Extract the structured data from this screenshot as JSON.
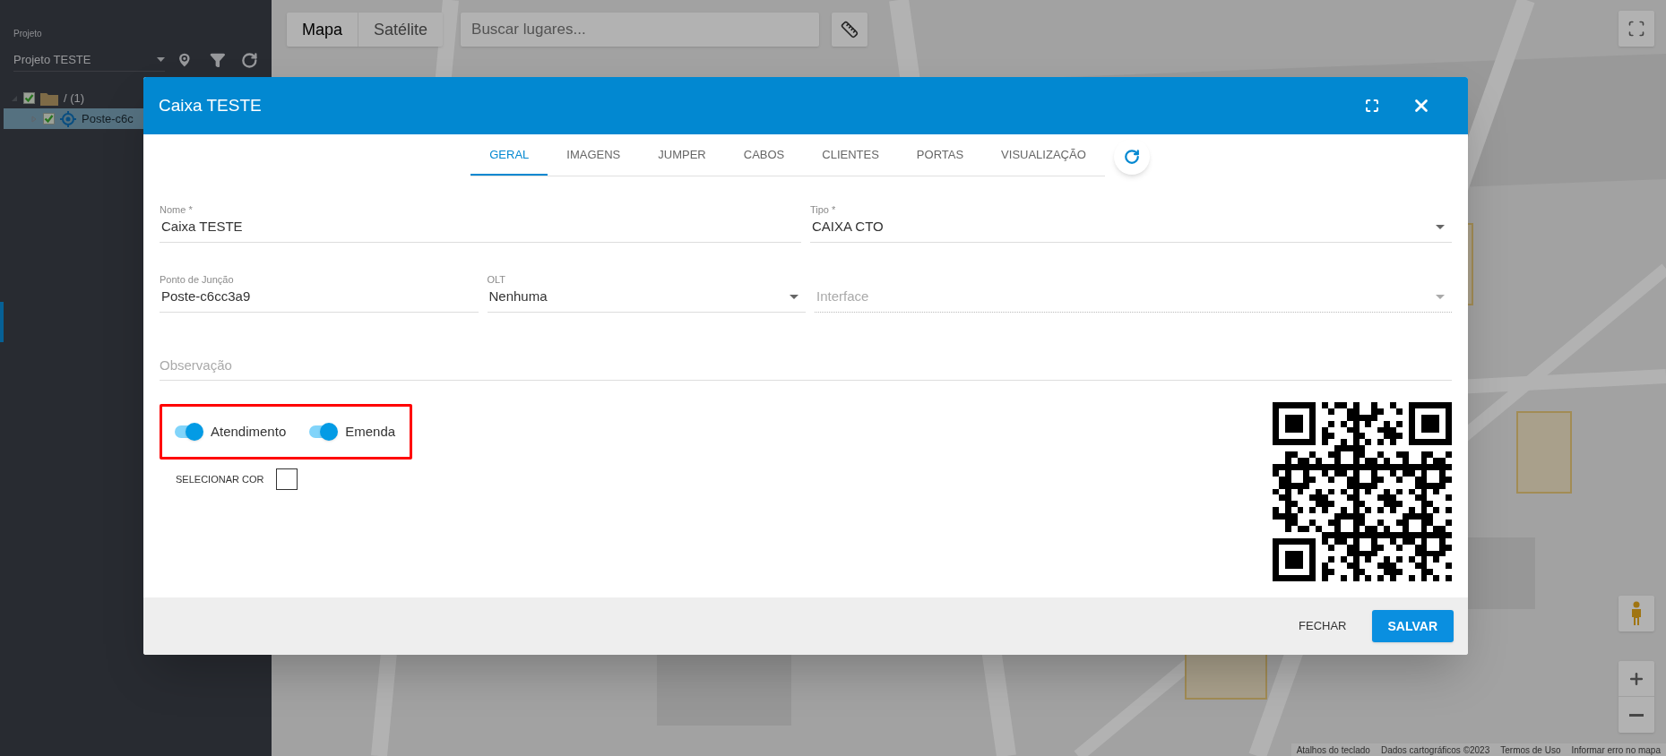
{
  "sidebar": {
    "project_label": "Projeto",
    "project_value": "Projeto TESTE",
    "tree": [
      {
        "label": "/ (1)",
        "checked": true,
        "expanded": true,
        "selected": false,
        "children": [
          {
            "label": "Poste-c6c",
            "checked": true,
            "expanded": false,
            "selected": true
          }
        ]
      }
    ]
  },
  "map": {
    "map_types": [
      {
        "label": "Mapa",
        "selected": true
      },
      {
        "label": "Satélite",
        "selected": false
      }
    ],
    "search_placeholder": "Buscar lugares...",
    "attribution": [
      "Atalhos do teclado",
      "Dados cartográficos ©2023",
      "Termos de Uso",
      "Informar erro no mapa"
    ]
  },
  "dialog": {
    "title": "Caixa TESTE",
    "tabs": [
      {
        "label": "GERAL",
        "selected": true
      },
      {
        "label": "IMAGENS",
        "selected": false
      },
      {
        "label": "JUMPER",
        "selected": false
      },
      {
        "label": "CABOS",
        "selected": false
      },
      {
        "label": "CLIENTES",
        "selected": false
      },
      {
        "label": "PORTAS",
        "selected": false
      },
      {
        "label": "VISUALIZAÇÃO",
        "selected": false
      }
    ],
    "fields": {
      "nome": {
        "kind": "text",
        "label": "Nome *",
        "value": "Caixa TESTE"
      },
      "tipo": {
        "kind": "select",
        "label": "Tipo *",
        "value": "CAIXA CTO"
      },
      "ponto_de_juncao": {
        "kind": "text",
        "label": "Ponto de Junção",
        "value": "Poste-c6cc3a9"
      },
      "olt": {
        "kind": "select",
        "label": "OLT",
        "value": "Nenhuma"
      },
      "interface": {
        "kind": "select",
        "placeholder": "Interface",
        "disabled": true
      }
    },
    "observation": {
      "placeholder": "Observação"
    },
    "toggles": [
      {
        "label": "Atendimento",
        "on": true
      },
      {
        "label": "Emenda",
        "on": true
      }
    ],
    "color_picker": {
      "label": "SELECIONAR COR"
    },
    "buttons": {
      "close": "FECHAR",
      "save": "SALVAR"
    }
  }
}
